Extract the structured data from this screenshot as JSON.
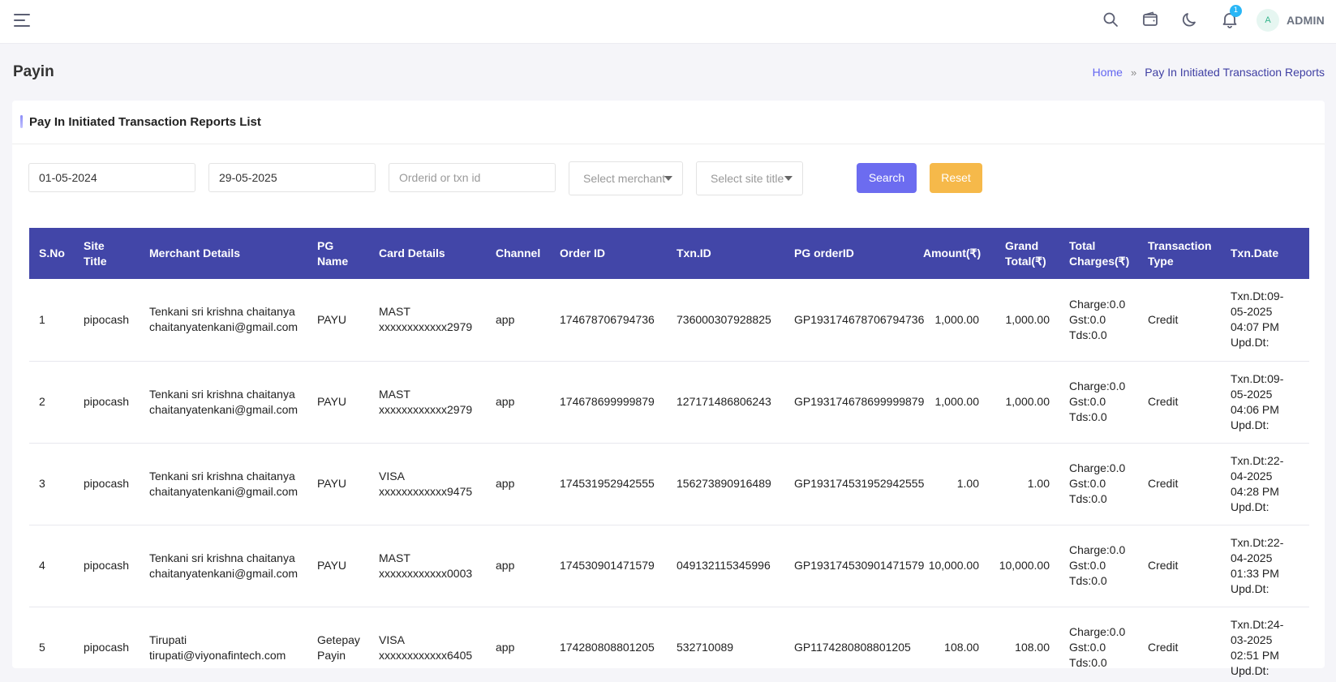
{
  "header": {
    "menu_icon": "hamburger-menu-icon",
    "icons": [
      "search-icon",
      "wallet-icon",
      "moon-icon",
      "bell-icon"
    ],
    "notification_count": "1",
    "avatar_initial": "A",
    "user_label": "ADMIN"
  },
  "page": {
    "title": "Payin",
    "breadcrumb": {
      "home": "Home",
      "separator": "»",
      "current": "Pay In Initiated Transaction Reports"
    }
  },
  "card": {
    "title": "Pay In Initiated Transaction Reports List"
  },
  "filters": {
    "from_date": "01-05-2024",
    "to_date": "29-05-2025",
    "order_placeholder": "Orderid or txn id",
    "merchant_placeholder": "Select merchant",
    "site_placeholder": "Select site title",
    "search_label": "Search",
    "reset_label": "Reset"
  },
  "table": {
    "headers": {
      "sno": "S.No",
      "site_title_1": "Site",
      "site_title_2": "Title",
      "merchant": "Merchant Details",
      "pg_1": "PG",
      "pg_2": "Name",
      "card": "Card Details",
      "channel": "Channel",
      "order": "Order ID",
      "txn": "Txn.ID",
      "pg_order": "PG orderID",
      "amount": "Amount(₹)",
      "grand_1": "Grand",
      "grand_2": "Total(₹)",
      "charges_1": "Total",
      "charges_2": "Charges(₹)",
      "type_1": "Transaction",
      "type_2": "Type",
      "date": "Txn.Date"
    },
    "rows": [
      {
        "sno": "1",
        "site": "pipocash",
        "merchant_name": "Tenkani sri krishna chaitanya",
        "merchant_email": "chaitanyatenkani@gmail.com",
        "pg_1": "PAYU",
        "pg_2": "",
        "card_type": "MAST",
        "card_number": "xxxxxxxxxxxx2979",
        "channel": "app",
        "order_id": "174678706794736",
        "txn_id": "736000307928825",
        "pg_order_id": "GP193174678706794736",
        "amount": "1,000.00",
        "grand_total": "1,000.00",
        "charge": "Charge:0.0",
        "gst": "Gst:0.0",
        "tds": "Tds:0.0",
        "type": "Credit",
        "date_1": "Txn.Dt:09-",
        "date_2": "05-2025",
        "date_3": "04:07 PM",
        "date_4": "Upd.Dt:"
      },
      {
        "sno": "2",
        "site": "pipocash",
        "merchant_name": "Tenkani sri krishna chaitanya",
        "merchant_email": "chaitanyatenkani@gmail.com",
        "pg_1": "PAYU",
        "pg_2": "",
        "card_type": "MAST",
        "card_number": "xxxxxxxxxxxx2979",
        "channel": "app",
        "order_id": "174678699999879",
        "txn_id": "127171486806243",
        "pg_order_id": "GP193174678699999879",
        "amount": "1,000.00",
        "grand_total": "1,000.00",
        "charge": "Charge:0.0",
        "gst": "Gst:0.0",
        "tds": "Tds:0.0",
        "type": "Credit",
        "date_1": "Txn.Dt:09-",
        "date_2": "05-2025",
        "date_3": "04:06 PM",
        "date_4": "Upd.Dt:"
      },
      {
        "sno": "3",
        "site": "pipocash",
        "merchant_name": "Tenkani sri krishna chaitanya",
        "merchant_email": "chaitanyatenkani@gmail.com",
        "pg_1": "PAYU",
        "pg_2": "",
        "card_type": "VISA",
        "card_number": "xxxxxxxxxxxx9475",
        "channel": "app",
        "order_id": "174531952942555",
        "txn_id": "156273890916489",
        "pg_order_id": "GP193174531952942555",
        "amount": "1.00",
        "grand_total": "1.00",
        "charge": "Charge:0.0",
        "gst": "Gst:0.0",
        "tds": "Tds:0.0",
        "type": "Credit",
        "date_1": "Txn.Dt:22-",
        "date_2": "04-2025",
        "date_3": "04:28 PM",
        "date_4": "Upd.Dt:"
      },
      {
        "sno": "4",
        "site": "pipocash",
        "merchant_name": "Tenkani sri krishna chaitanya",
        "merchant_email": "chaitanyatenkani@gmail.com",
        "pg_1": "PAYU",
        "pg_2": "",
        "card_type": "MAST",
        "card_number": "xxxxxxxxxxxx0003",
        "channel": "app",
        "order_id": "174530901471579",
        "txn_id": "049132115345996",
        "pg_order_id": "GP193174530901471579",
        "amount": "10,000.00",
        "grand_total": "10,000.00",
        "charge": "Charge:0.0",
        "gst": "Gst:0.0",
        "tds": "Tds:0.0",
        "type": "Credit",
        "date_1": "Txn.Dt:22-",
        "date_2": "04-2025",
        "date_3": "01:33 PM",
        "date_4": "Upd.Dt:"
      },
      {
        "sno": "5",
        "site": "pipocash",
        "merchant_name": "Tirupati",
        "merchant_email": "tirupati@viyonafintech.com",
        "pg_1": "Getepay",
        "pg_2": "Payin",
        "card_type": "VISA",
        "card_number": "xxxxxxxxxxxx6405",
        "channel": "app",
        "order_id": "174280808801205",
        "txn_id": "532710089",
        "pg_order_id": "GP1174280808801205",
        "amount": "108.00",
        "grand_total": "108.00",
        "charge": "Charge:0.0",
        "gst": "Gst:0.0",
        "tds": "Tds:0.0",
        "type": "Credit",
        "date_1": "Txn.Dt:24-",
        "date_2": "03-2025",
        "date_3": "02:51 PM",
        "date_4": "Upd.Dt:"
      }
    ]
  },
  "colors": {
    "table_header": "#4246a8",
    "search_button": "#6c6cf0",
    "reset_button": "#f6b94a",
    "breadcrumb_link": "#6366f1"
  }
}
